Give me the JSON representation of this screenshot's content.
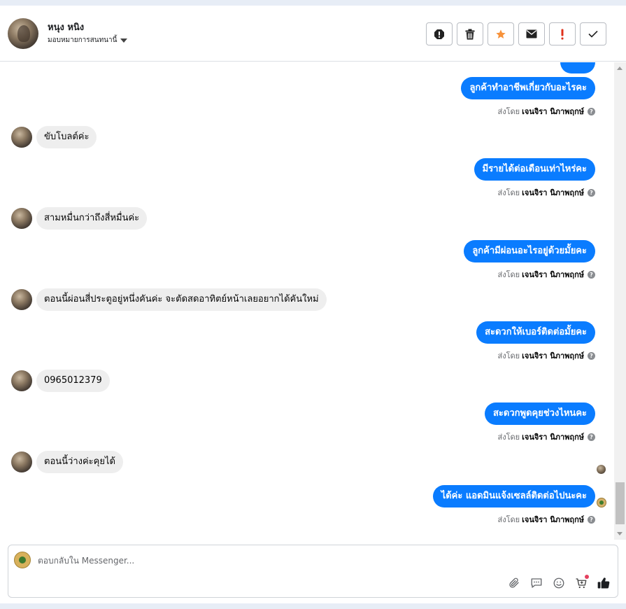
{
  "header": {
    "name": "หนุง หนิง",
    "assign_label": "มอบหมายการสนทนานี้"
  },
  "actions": [
    {
      "name": "report-icon"
    },
    {
      "name": "trash-icon"
    },
    {
      "name": "star-icon",
      "color": "#f7923a"
    },
    {
      "name": "mail-icon"
    },
    {
      "name": "exclamation-icon",
      "color": "#e0311b"
    },
    {
      "name": "check-icon"
    }
  ],
  "messages": [
    {
      "dir": "out",
      "text": "ลูกค้าทำอาชีพเกี่ยวกับอะไรคะ"
    },
    {
      "dir": "in",
      "text": "ขับโบลต์ค่ะ"
    },
    {
      "dir": "out",
      "text": "มีรายได้ต่อเดือนเท่าไหร่คะ"
    },
    {
      "dir": "in",
      "text": "สามหมื่นกว่าถึงสี่หมื่นค่ะ"
    },
    {
      "dir": "out",
      "text": "ลูกค้ามีผ่อนอะไรอยู่ด้วยมั้ยคะ"
    },
    {
      "dir": "in",
      "text": "ตอนนี้ผ่อนสี่ประตูอยู่หนึ่งคันค่ะ จะตัดสดอาทิตย์หน้าเลยอยากได้คันใหม่"
    },
    {
      "dir": "out",
      "text": "สะดวกให้เบอร์ติดต่อมั้ยคะ"
    },
    {
      "dir": "in",
      "text": "0965012379"
    },
    {
      "dir": "out",
      "text": "สะดวกพูดคุยช่วงไหนคะ"
    },
    {
      "dir": "in",
      "text": "ตอนนี้ว่างค่ะคุยได้"
    },
    {
      "dir": "out",
      "text": "ได้ค่ะ แอดมินแจ้งเซลล์ติดต่อไปนะคะ"
    }
  ],
  "sent_by": {
    "prefix": "ส่งโดย",
    "agent": "เจนจิรา นิภาพฤกษ์"
  },
  "composer": {
    "placeholder": "ตอบกลับใน Messenger...",
    "tools": [
      "paperclip-icon",
      "chat-bubble-icon",
      "smile-icon",
      "cart-add-icon",
      "thumbs-up-icon"
    ]
  },
  "colors": {
    "accent": "#0a7cff",
    "incoming_bg": "#eeeeee"
  }
}
